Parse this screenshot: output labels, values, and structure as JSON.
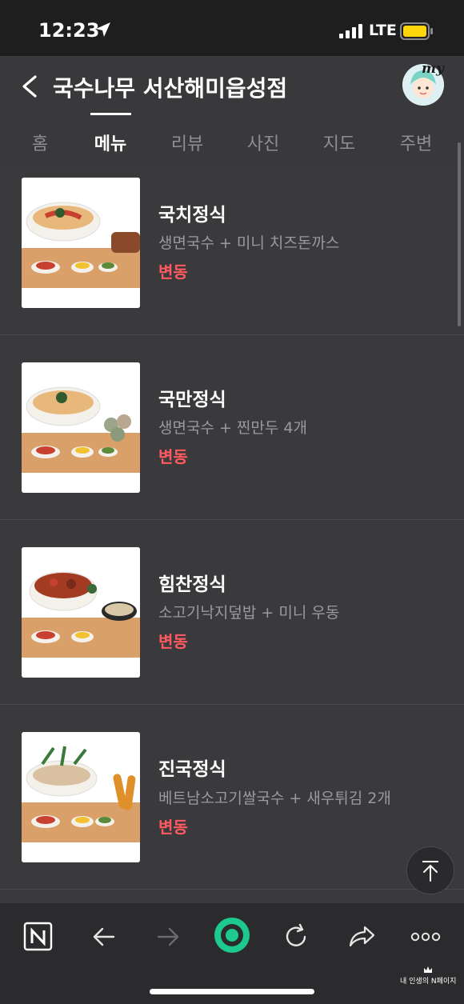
{
  "status_bar": {
    "time": "12:23",
    "network": "LTE"
  },
  "header": {
    "title": "국수나무 서산해미읍성점",
    "my_badge": "my"
  },
  "tabs": [
    {
      "label": "홈"
    },
    {
      "label": "메뉴",
      "active": true
    },
    {
      "label": "리뷰"
    },
    {
      "label": "사진"
    },
    {
      "label": "지도"
    },
    {
      "label": "주변"
    }
  ],
  "menu_items": [
    {
      "name": "국치정식",
      "desc": "생면국수 + 미니 치즈돈까스",
      "price": "변동"
    },
    {
      "name": "국만정식",
      "desc": "생면국수 + 찐만두 4개",
      "price": "변동"
    },
    {
      "name": "힘찬정식",
      "desc": "소고기낙지덮밥 + 미니 우동",
      "price": "변동"
    },
    {
      "name": "진국정식",
      "desc": "베트남소고기쌀국수 + 새우튀김 2개",
      "price": "변동"
    }
  ],
  "bottom_nav": {
    "brand_note": "내 인생의 N페이지",
    "icons": [
      "naver-home-icon",
      "back-arrow-icon",
      "forward-arrow-icon",
      "green-dot-icon",
      "refresh-icon",
      "share-icon",
      "more-icon"
    ]
  },
  "colors": {
    "accent_price": "#ff5a5f",
    "background": "#3a3a3c",
    "bottom_bar": "#2b2b2d",
    "green": "#1ec98f"
  }
}
